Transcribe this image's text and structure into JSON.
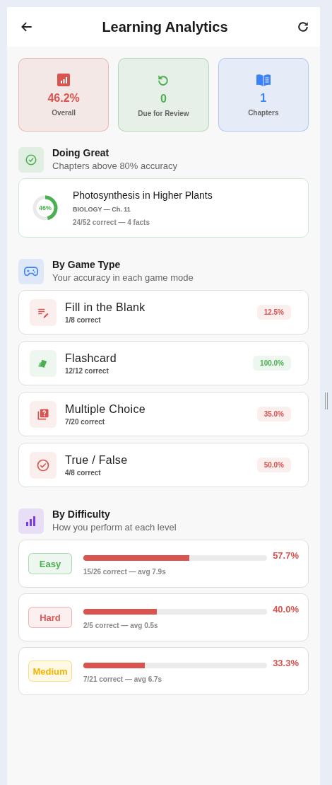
{
  "header": {
    "title": "Learning Analytics"
  },
  "stats": [
    {
      "kind": "chart",
      "value": "46.2%",
      "label": "Overall",
      "color": "#d9534f"
    },
    {
      "kind": "review",
      "value": "0",
      "label": "Due for Review",
      "color": "#4caf50"
    },
    {
      "kind": "book",
      "value": "1",
      "label": "Chapters",
      "color": "#3b82f6"
    }
  ],
  "doing_great": {
    "title": "Doing Great",
    "subtitle": "Chapters above 80% accuracy",
    "chapters": [
      {
        "percent": "46%",
        "title": "Photosynthesis in Higher Plants",
        "subject": "BIOLOGY — Ch. 11",
        "detail": "24/52 correct — 4 facts"
      }
    ]
  },
  "game_types": {
    "title": "By Game Type",
    "subtitle": "Your accuracy in each game mode",
    "items": [
      {
        "kind": "fill",
        "name": "Fill in the Blank",
        "detail": "1/8 correct",
        "accuracy": "12.5%",
        "color": "#d9534f"
      },
      {
        "kind": "flashcard",
        "name": "Flashcard",
        "detail": "12/12 correct",
        "accuracy": "100.0%",
        "color": "#4caf50"
      },
      {
        "kind": "choice",
        "name": "Multiple Choice",
        "detail": "7/20 correct",
        "accuracy": "35.0%",
        "color": "#d9534f"
      },
      {
        "kind": "truefalse",
        "name": "True / False",
        "detail": "4/8 correct",
        "accuracy": "50.0%",
        "color": "#d9534f"
      }
    ]
  },
  "difficulty": {
    "title": "By Difficulty",
    "subtitle": "How you perform at each level",
    "levels": [
      {
        "label": "Easy",
        "color": "#4caf50",
        "level": 0.577,
        "accuracy": "57.7%",
        "detail": "15/26 correct — avg 7.9s"
      },
      {
        "label": "Hard",
        "color": "#e05555",
        "level": 0.4,
        "accuracy": "40.0%",
        "detail": "2/5 correct — avg 0.5s"
      },
      {
        "label": "Medium",
        "color": "#f5b400",
        "level": 0.333,
        "accuracy": "33.3%",
        "detail": "7/21 correct — avg 6.7s"
      }
    ]
  }
}
